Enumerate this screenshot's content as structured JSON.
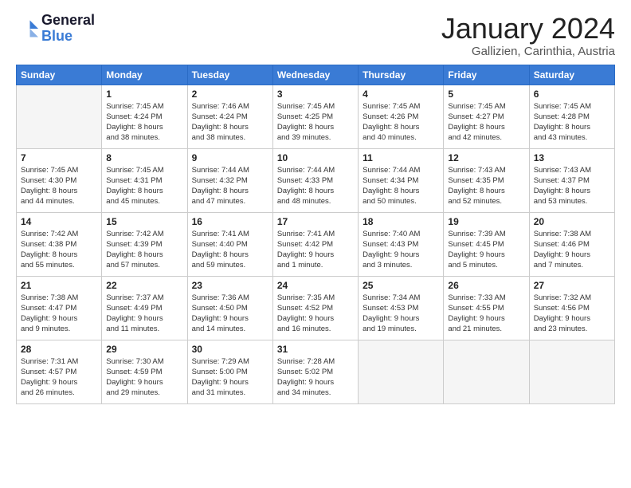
{
  "header": {
    "logo_line1": "General",
    "logo_line2": "Blue",
    "month_title": "January 2024",
    "subtitle": "Gallizien, Carinthia, Austria"
  },
  "weekdays": [
    "Sunday",
    "Monday",
    "Tuesday",
    "Wednesday",
    "Thursday",
    "Friday",
    "Saturday"
  ],
  "weeks": [
    [
      {
        "day": "",
        "info": ""
      },
      {
        "day": "1",
        "info": "Sunrise: 7:45 AM\nSunset: 4:24 PM\nDaylight: 8 hours\nand 38 minutes."
      },
      {
        "day": "2",
        "info": "Sunrise: 7:46 AM\nSunset: 4:24 PM\nDaylight: 8 hours\nand 38 minutes."
      },
      {
        "day": "3",
        "info": "Sunrise: 7:45 AM\nSunset: 4:25 PM\nDaylight: 8 hours\nand 39 minutes."
      },
      {
        "day": "4",
        "info": "Sunrise: 7:45 AM\nSunset: 4:26 PM\nDaylight: 8 hours\nand 40 minutes."
      },
      {
        "day": "5",
        "info": "Sunrise: 7:45 AM\nSunset: 4:27 PM\nDaylight: 8 hours\nand 42 minutes."
      },
      {
        "day": "6",
        "info": "Sunrise: 7:45 AM\nSunset: 4:28 PM\nDaylight: 8 hours\nand 43 minutes."
      }
    ],
    [
      {
        "day": "7",
        "info": "Sunrise: 7:45 AM\nSunset: 4:30 PM\nDaylight: 8 hours\nand 44 minutes."
      },
      {
        "day": "8",
        "info": "Sunrise: 7:45 AM\nSunset: 4:31 PM\nDaylight: 8 hours\nand 45 minutes."
      },
      {
        "day": "9",
        "info": "Sunrise: 7:44 AM\nSunset: 4:32 PM\nDaylight: 8 hours\nand 47 minutes."
      },
      {
        "day": "10",
        "info": "Sunrise: 7:44 AM\nSunset: 4:33 PM\nDaylight: 8 hours\nand 48 minutes."
      },
      {
        "day": "11",
        "info": "Sunrise: 7:44 AM\nSunset: 4:34 PM\nDaylight: 8 hours\nand 50 minutes."
      },
      {
        "day": "12",
        "info": "Sunrise: 7:43 AM\nSunset: 4:35 PM\nDaylight: 8 hours\nand 52 minutes."
      },
      {
        "day": "13",
        "info": "Sunrise: 7:43 AM\nSunset: 4:37 PM\nDaylight: 8 hours\nand 53 minutes."
      }
    ],
    [
      {
        "day": "14",
        "info": "Sunrise: 7:42 AM\nSunset: 4:38 PM\nDaylight: 8 hours\nand 55 minutes."
      },
      {
        "day": "15",
        "info": "Sunrise: 7:42 AM\nSunset: 4:39 PM\nDaylight: 8 hours\nand 57 minutes."
      },
      {
        "day": "16",
        "info": "Sunrise: 7:41 AM\nSunset: 4:40 PM\nDaylight: 8 hours\nand 59 minutes."
      },
      {
        "day": "17",
        "info": "Sunrise: 7:41 AM\nSunset: 4:42 PM\nDaylight: 9 hours\nand 1 minute."
      },
      {
        "day": "18",
        "info": "Sunrise: 7:40 AM\nSunset: 4:43 PM\nDaylight: 9 hours\nand 3 minutes."
      },
      {
        "day": "19",
        "info": "Sunrise: 7:39 AM\nSunset: 4:45 PM\nDaylight: 9 hours\nand 5 minutes."
      },
      {
        "day": "20",
        "info": "Sunrise: 7:38 AM\nSunset: 4:46 PM\nDaylight: 9 hours\nand 7 minutes."
      }
    ],
    [
      {
        "day": "21",
        "info": "Sunrise: 7:38 AM\nSunset: 4:47 PM\nDaylight: 9 hours\nand 9 minutes."
      },
      {
        "day": "22",
        "info": "Sunrise: 7:37 AM\nSunset: 4:49 PM\nDaylight: 9 hours\nand 11 minutes."
      },
      {
        "day": "23",
        "info": "Sunrise: 7:36 AM\nSunset: 4:50 PM\nDaylight: 9 hours\nand 14 minutes."
      },
      {
        "day": "24",
        "info": "Sunrise: 7:35 AM\nSunset: 4:52 PM\nDaylight: 9 hours\nand 16 minutes."
      },
      {
        "day": "25",
        "info": "Sunrise: 7:34 AM\nSunset: 4:53 PM\nDaylight: 9 hours\nand 19 minutes."
      },
      {
        "day": "26",
        "info": "Sunrise: 7:33 AM\nSunset: 4:55 PM\nDaylight: 9 hours\nand 21 minutes."
      },
      {
        "day": "27",
        "info": "Sunrise: 7:32 AM\nSunset: 4:56 PM\nDaylight: 9 hours\nand 23 minutes."
      }
    ],
    [
      {
        "day": "28",
        "info": "Sunrise: 7:31 AM\nSunset: 4:57 PM\nDaylight: 9 hours\nand 26 minutes."
      },
      {
        "day": "29",
        "info": "Sunrise: 7:30 AM\nSunset: 4:59 PM\nDaylight: 9 hours\nand 29 minutes."
      },
      {
        "day": "30",
        "info": "Sunrise: 7:29 AM\nSunset: 5:00 PM\nDaylight: 9 hours\nand 31 minutes."
      },
      {
        "day": "31",
        "info": "Sunrise: 7:28 AM\nSunset: 5:02 PM\nDaylight: 9 hours\nand 34 minutes."
      },
      {
        "day": "",
        "info": ""
      },
      {
        "day": "",
        "info": ""
      },
      {
        "day": "",
        "info": ""
      }
    ]
  ]
}
